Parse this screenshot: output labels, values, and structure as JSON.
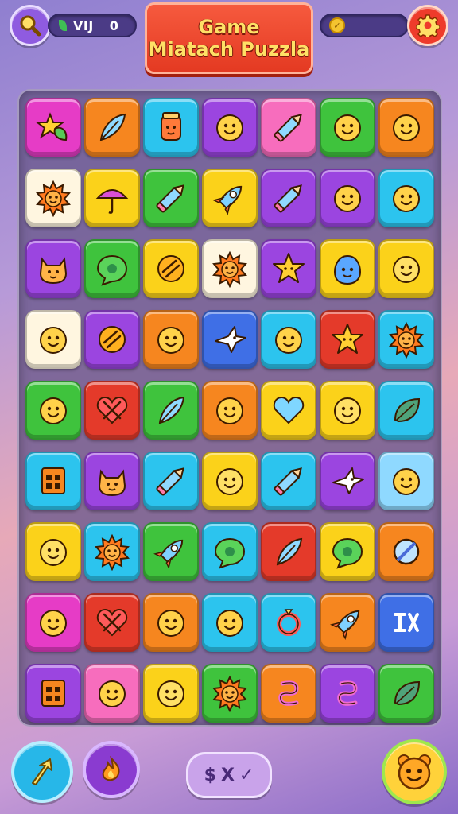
{
  "header": {
    "title_line1": "Game",
    "title_line2": "Miatach Puzzla",
    "left_counter": {
      "label": "VIJ",
      "value": "0"
    },
    "right_counter": {
      "icon": "coin-icon",
      "level_fraction": 0.0
    }
  },
  "buttons": {
    "search": {
      "icon": "magnifier-icon"
    },
    "settings": {
      "icon": "gear-icon"
    },
    "boost_arrow": {
      "icon": "arrow-up-icon"
    },
    "boost_fire": {
      "icon": "flame-icon"
    },
    "shuffle": {
      "labels": [
        "$",
        "X",
        "✓"
      ]
    },
    "character": {
      "icon": "creature-face-icon"
    }
  },
  "colors": {
    "magenta": "#e63cc6",
    "orange": "#f6861f",
    "cyan": "#2cc4ee",
    "purple": "#9b45e0",
    "pink": "#f76dbd",
    "green": "#3fc33d",
    "yellow": "#fbd21a",
    "red": "#e43a2a",
    "blue": "#3f6fe6",
    "white": "#fff6e0",
    "lightblue": "#8fd9ff"
  },
  "grid": {
    "rows": [
      [
        {
          "c": "magenta",
          "i": "leaf-star"
        },
        {
          "c": "orange",
          "i": "feather"
        },
        {
          "c": "cyan",
          "i": "jar-face"
        },
        {
          "c": "purple",
          "i": "smiley"
        },
        {
          "c": "pink",
          "i": "pencil"
        },
        {
          "c": "green",
          "i": "smiley"
        },
        {
          "c": "orange",
          "i": "smiley"
        }
      ],
      [
        {
          "c": "white",
          "i": "sun-face"
        },
        {
          "c": "yellow",
          "i": "umbrella"
        },
        {
          "c": "green",
          "i": "pencil"
        },
        {
          "c": "yellow",
          "i": "rocket"
        },
        {
          "c": "purple",
          "i": "pencil"
        },
        {
          "c": "purple",
          "i": "smiley"
        },
        {
          "c": "cyan",
          "i": "smiley"
        }
      ],
      [
        {
          "c": "purple",
          "i": "cat-face"
        },
        {
          "c": "green",
          "i": "bubble"
        },
        {
          "c": "yellow",
          "i": "stripes"
        },
        {
          "c": "white",
          "i": "sun-face"
        },
        {
          "c": "purple",
          "i": "star-face"
        },
        {
          "c": "yellow",
          "i": "blob-face"
        },
        {
          "c": "yellow",
          "i": "smiley"
        }
      ],
      [
        {
          "c": "white",
          "i": "smiley"
        },
        {
          "c": "purple",
          "i": "stripes"
        },
        {
          "c": "orange",
          "i": "smiley"
        },
        {
          "c": "blue",
          "i": "bird"
        },
        {
          "c": "cyan",
          "i": "smiley"
        },
        {
          "c": "red",
          "i": "star-face"
        },
        {
          "c": "cyan",
          "i": "sun-face"
        }
      ],
      [
        {
          "c": "green",
          "i": "smiley"
        },
        {
          "c": "red",
          "i": "heart-x"
        },
        {
          "c": "green",
          "i": "feather"
        },
        {
          "c": "orange",
          "i": "smiley"
        },
        {
          "c": "yellow",
          "i": "heart"
        },
        {
          "c": "yellow",
          "i": "smiley"
        },
        {
          "c": "cyan",
          "i": "leaf"
        }
      ],
      [
        {
          "c": "cyan",
          "i": "box"
        },
        {
          "c": "purple",
          "i": "cat-face"
        },
        {
          "c": "cyan",
          "i": "pencil"
        },
        {
          "c": "yellow",
          "i": "smiley"
        },
        {
          "c": "cyan",
          "i": "pencil"
        },
        {
          "c": "purple",
          "i": "bird"
        },
        {
          "c": "lightblue",
          "i": "smiley"
        }
      ],
      [
        {
          "c": "yellow",
          "i": "smiley"
        },
        {
          "c": "cyan",
          "i": "sun-face"
        },
        {
          "c": "green",
          "i": "rocket"
        },
        {
          "c": "cyan",
          "i": "bubble"
        },
        {
          "c": "red",
          "i": "feather"
        },
        {
          "c": "yellow",
          "i": "bubble"
        },
        {
          "c": "orange",
          "i": "no-sign"
        }
      ],
      [
        {
          "c": "magenta",
          "i": "smiley"
        },
        {
          "c": "red",
          "i": "heart-x"
        },
        {
          "c": "orange",
          "i": "smiley"
        },
        {
          "c": "cyan",
          "i": "smiley"
        },
        {
          "c": "cyan",
          "i": "ring"
        },
        {
          "c": "orange",
          "i": "rocket"
        },
        {
          "c": "blue",
          "i": "glyph"
        }
      ],
      [
        {
          "c": "purple",
          "i": "box"
        },
        {
          "c": "pink",
          "i": "smiley"
        },
        {
          "c": "yellow",
          "i": "smiley"
        },
        {
          "c": "green",
          "i": "sun-face"
        },
        {
          "c": "orange",
          "i": "swirl"
        },
        {
          "c": "purple",
          "i": "swirl"
        },
        {
          "c": "green",
          "i": "leaf"
        }
      ]
    ]
  }
}
